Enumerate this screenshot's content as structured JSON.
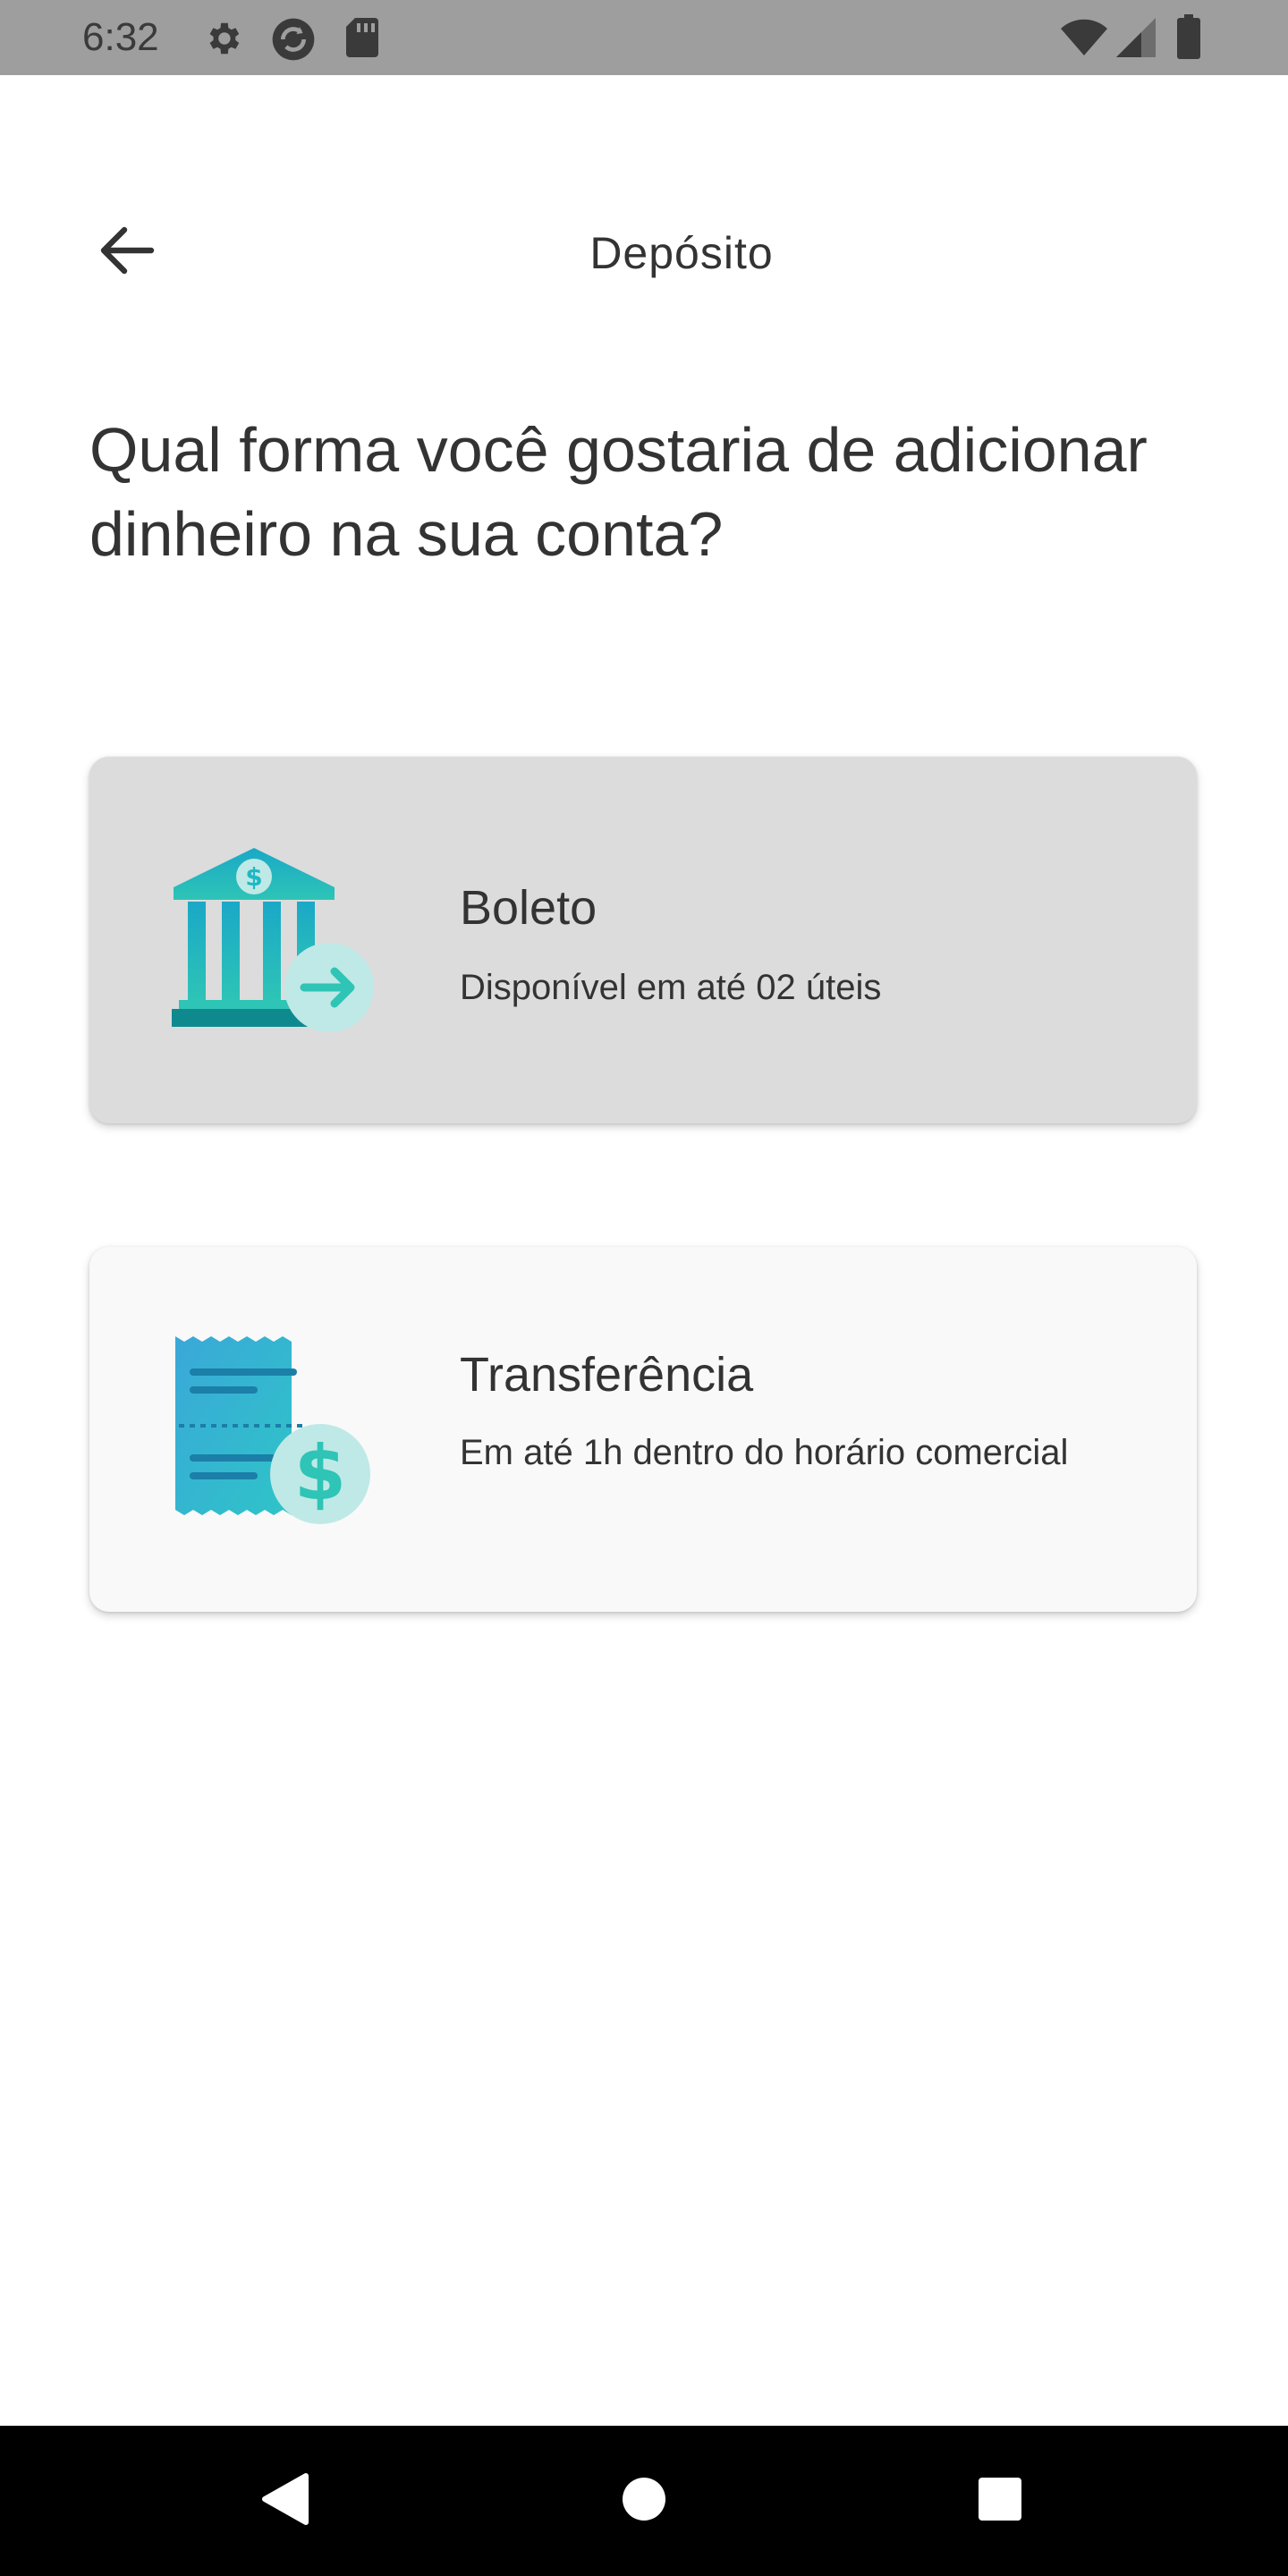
{
  "status_bar": {
    "time": "6:32",
    "icons_left": [
      "gear-icon",
      "sync-icon",
      "sd-card-icon"
    ],
    "icons_right": [
      "wifi-icon",
      "signal-icon",
      "battery-icon"
    ]
  },
  "header": {
    "back_icon": "arrow-left-icon",
    "title": "Depósito"
  },
  "question": "Qual forma você gostaria de adicionar dinheiro na sua conta?",
  "options": [
    {
      "icon": "bank-transfer-icon",
      "title": "Boleto",
      "description": "Disponível em até 02 úteis",
      "state": "pressed"
    },
    {
      "icon": "receipt-dollar-icon",
      "title": "Transferência",
      "description": "Em até 1h dentro do horário comercial"
    }
  ],
  "nav_bar": {
    "buttons": [
      "back-triangle-icon",
      "home-circle-icon",
      "recents-square-icon"
    ]
  },
  "colors": {
    "accent_teal": "#1fb8c4",
    "accent_dark": "#0e8a8f",
    "accent_light": "#bfe9e6"
  }
}
